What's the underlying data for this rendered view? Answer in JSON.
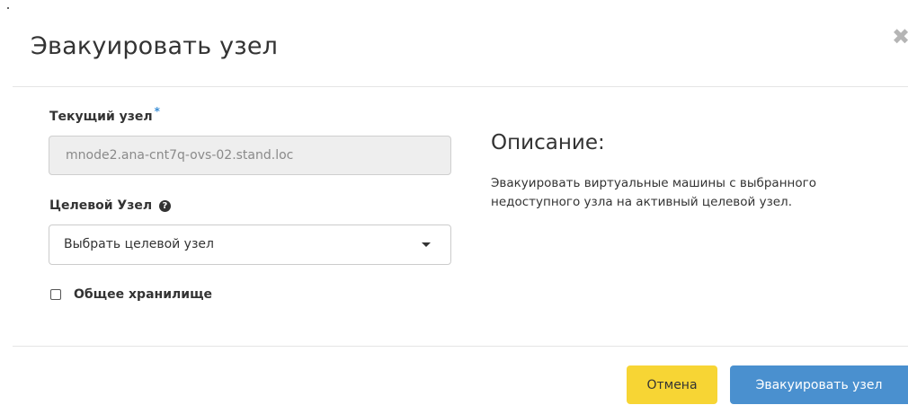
{
  "modal": {
    "title": "Эвакуировать узел",
    "close_icon": "close-icon"
  },
  "form": {
    "current_node": {
      "label": "Текущий узел",
      "required_mark": "*",
      "value": "mnode2.ana-cnt7q-ovs-02.stand.loc"
    },
    "target_node": {
      "label": "Целевой Узел",
      "help_icon": "question-circle-icon",
      "selected": "Выбрать целевой узел"
    },
    "shared_storage": {
      "label": "Общее хранилище",
      "checked": false
    }
  },
  "description": {
    "title": "Описание:",
    "text": "Эвакуировать виртуальные машины с выбранного недоступного узла на активный целевой узел."
  },
  "footer": {
    "cancel_label": "Отмена",
    "submit_label": "Эвакуировать узел"
  },
  "colors": {
    "cancel_bg": "#f7d534",
    "submit_bg": "#4a90cf",
    "required_star": "#3b8fd6"
  }
}
